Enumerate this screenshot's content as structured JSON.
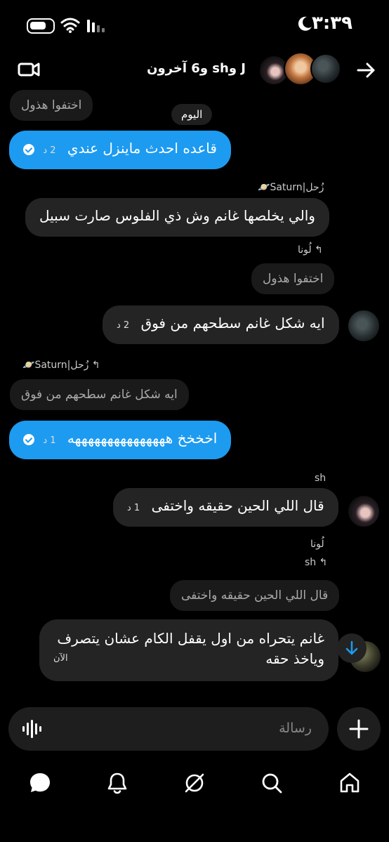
{
  "status": {
    "time": "٣:٣٩"
  },
  "header": {
    "title": "J وsh و6 آخرون"
  },
  "day_divider": "اليوم",
  "messages": {
    "m0": {
      "text": "اختفوا هذول"
    },
    "m1": {
      "text": "قاعده احدث ماينزل عندي",
      "time": "2 د"
    },
    "m2": {
      "sender": "زُحل|Saturn🪐",
      "text": "والي يخلصها غانم وش ذي الفلوس صارت سبيل"
    },
    "m3": {
      "reply_label": "لُونا",
      "quote": "اختفوا هذول",
      "text": "ايه شكل غانم سطحهم من فوق",
      "time": "2 د"
    },
    "m4": {
      "reply_label": "زُحل|Saturn🪐",
      "quote": "ايه شكل غانم سطحهم من فوق",
      "text": "اخخخخ هههههههههههههههه",
      "time": "1 د"
    },
    "m5": {
      "sender": "sh",
      "text": "قال اللي الحين حقيقه واختفى",
      "time": "1 د"
    },
    "m6": {
      "sender": "لُونا",
      "reply_label": "sh",
      "quote": "قال اللي الحين حقيقه واختفى",
      "text_line1": "غانم يتحراه من اول يقفل الكام عشان يتصرف",
      "text_line2": "وياخذ حقه",
      "time": "الآن"
    }
  },
  "composer": {
    "placeholder": "رسالة"
  },
  "icons": {
    "back": "arrow-right-icon",
    "video": "video-camera-icon",
    "mic": "waveform-icon",
    "plus": "plus-icon",
    "scroll": "arrow-down-icon",
    "nav": [
      "chat-icon",
      "bell-icon",
      "compass-icon",
      "search-icon",
      "home-icon"
    ]
  },
  "colors": {
    "accent": "#1d9bf0",
    "bubble_dark": "#242424",
    "background": "#000000"
  }
}
